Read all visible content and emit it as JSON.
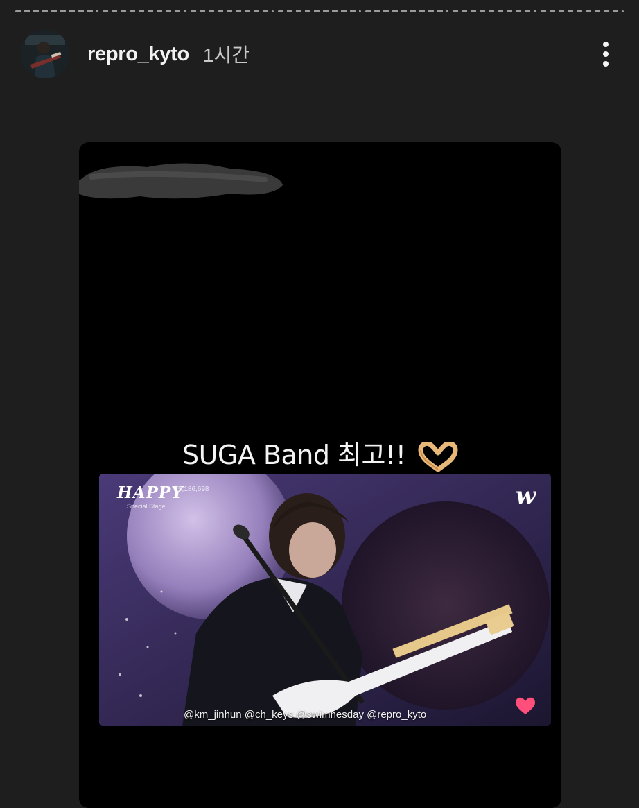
{
  "story": {
    "segments": [
      {
        "state": "done"
      },
      {
        "state": "done"
      },
      {
        "state": "done"
      },
      {
        "state": "current"
      },
      {
        "state": "upcoming"
      },
      {
        "state": "upcoming"
      },
      {
        "state": "upcoming"
      }
    ]
  },
  "header": {
    "username": "repro_kyto",
    "time": "1시간",
    "more_icon": "more-vertical-icon",
    "avatar_icon": "profile-avatar"
  },
  "post": {
    "caption": "SUGA Band 최고!!",
    "caption_emoji": "heart-hands-emoji",
    "video": {
      "brand": "HAPPY",
      "brand_sub": "Special Stage",
      "views": "5,186,698",
      "platform_logo": "w",
      "tags": "@km_jinhun @ch_keys @swimnesday @repro_kyto",
      "like_icon": "heart-icon"
    }
  },
  "colors": {
    "background": "#1e1e1e",
    "card": "#000000",
    "heart": "#ff4f7a"
  }
}
